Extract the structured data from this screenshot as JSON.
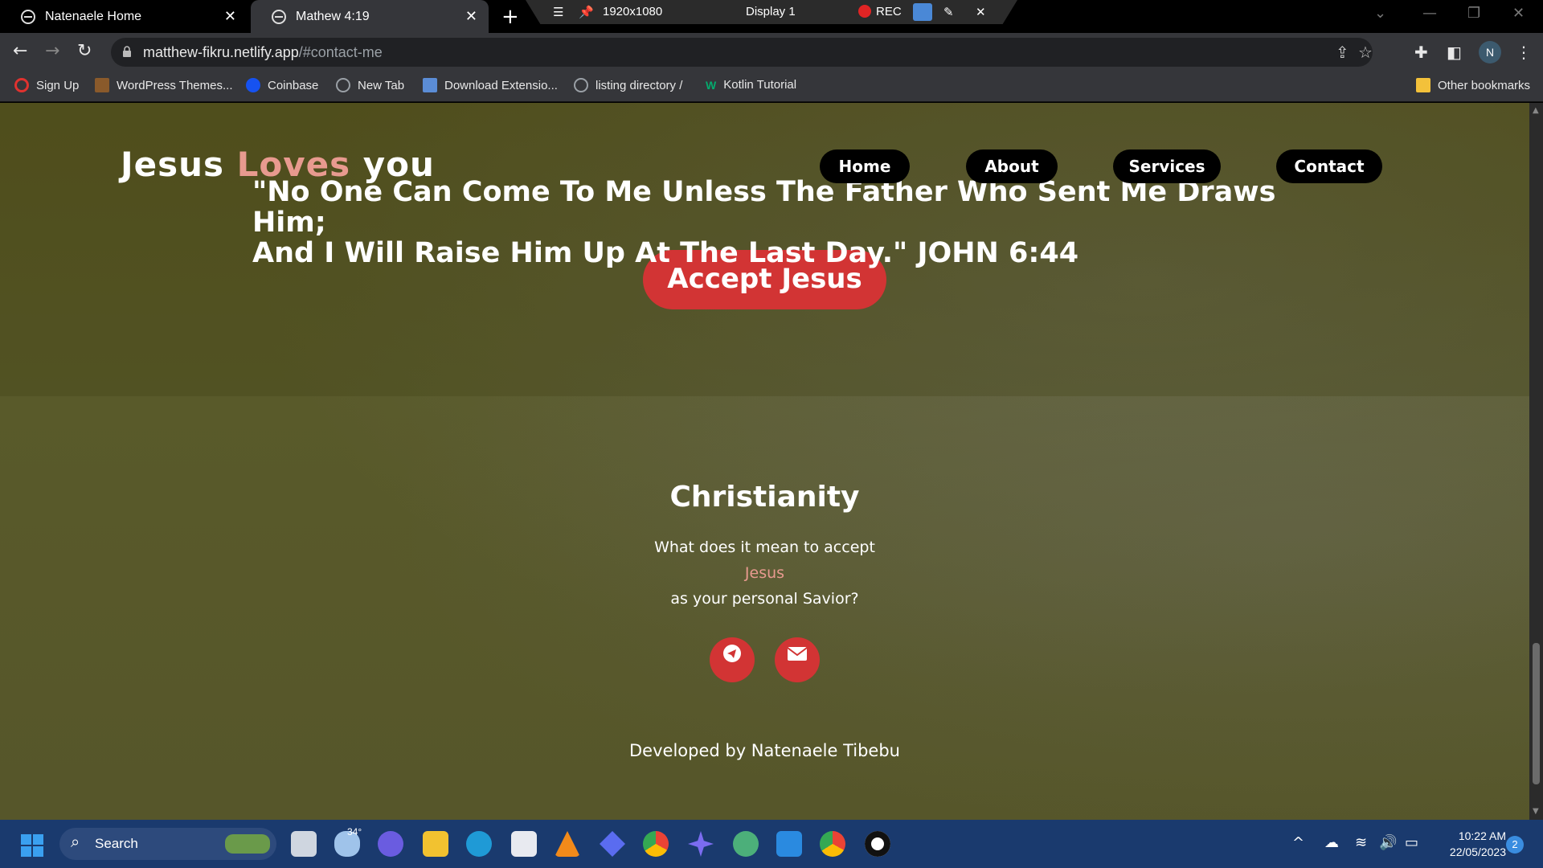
{
  "browser": {
    "tabs": [
      {
        "title": "Natenaele Home",
        "active": false
      },
      {
        "title": "Mathew 4:19",
        "active": true
      }
    ],
    "new_tab_glyph": "+",
    "recorder": {
      "resolution": "1920x1080",
      "display": "Display 1",
      "rec_label": "REC"
    },
    "url_host": "matthew-fikru.netlify.app",
    "url_path": "/#contact-me",
    "profile_initial": "N",
    "bookmarks": [
      {
        "label": "Sign Up",
        "icon": "opera-icon",
        "color": "#e0322f"
      },
      {
        "label": "WordPress Themes...",
        "icon": "book-icon",
        "color": "#8a5a2b"
      },
      {
        "label": "Coinbase",
        "icon": "coinbase-icon",
        "color": "#1652f0"
      },
      {
        "label": "New Tab",
        "icon": "globe-icon",
        "color": "#9aa0a6"
      },
      {
        "label": "Download Extensio...",
        "icon": "layers-icon",
        "color": "#5b8dd6"
      },
      {
        "label": "listing directory /",
        "icon": "globe-icon",
        "color": "#9aa0a6"
      },
      {
        "label": "Kotlin Tutorial",
        "icon": "w-icon",
        "color": "#04aa6d"
      }
    ],
    "other_bookmarks": "Other bookmarks"
  },
  "site": {
    "brand": {
      "part1": "Jesus ",
      "accent": "Loves",
      "part2": " you"
    },
    "nav": [
      "Home",
      "About",
      "Services",
      "Contact"
    ],
    "quote_line1": "\"No One Can Come To Me Unless The Father Who Sent Me Draws Him;",
    "quote_line2": "And I Will Raise Him Up At The Last Day.\" JOHN 6:44",
    "cta": "Accept Jesus",
    "section_title": "Christianity",
    "sub1": "What does it mean to accept",
    "sub2": "Jesus",
    "sub3": "as your personal Savior?",
    "footer": "Developed by Natenaele Tibebu",
    "accent_color": "#e89a8f",
    "button_color": "#d23434"
  },
  "taskbar": {
    "search_label": "Search",
    "weather": "34°",
    "time": "10:22 AM",
    "date": "22/05/2023",
    "notifications": "2"
  }
}
